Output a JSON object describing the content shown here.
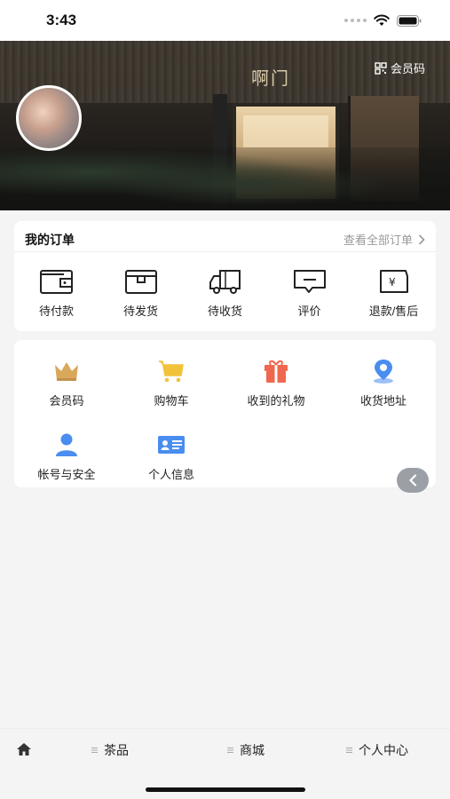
{
  "status_bar": {
    "time": "3:43"
  },
  "hero": {
    "logo_text": "啊门",
    "member_code_label": "会员码"
  },
  "orders": {
    "title": "我的订单",
    "view_all": "查看全部订单",
    "items": [
      {
        "label": "待付款",
        "icon": "wallet-icon"
      },
      {
        "label": "待发货",
        "icon": "package-icon"
      },
      {
        "label": "待收货",
        "icon": "truck-icon"
      },
      {
        "label": "评价",
        "icon": "comment-icon"
      },
      {
        "label": "退款/售后",
        "icon": "refund-icon"
      }
    ]
  },
  "services": {
    "items": [
      {
        "label": "会员码",
        "icon": "crown-icon",
        "color": "#d9a85b"
      },
      {
        "label": "购物车",
        "icon": "cart-icon",
        "color": "#f2c23a"
      },
      {
        "label": "收到的礼物",
        "icon": "gift-icon",
        "color": "#f0674f"
      },
      {
        "label": "收货地址",
        "icon": "location-icon",
        "color": "#4a8df0"
      },
      {
        "label": "帐号与安全",
        "icon": "user-icon",
        "color": "#4a8df0"
      },
      {
        "label": "个人信息",
        "icon": "id-card-icon",
        "color": "#4a8df0"
      }
    ]
  },
  "tabbar": {
    "tabs": [
      {
        "label": "茶品"
      },
      {
        "label": "商城"
      },
      {
        "label": "个人中心"
      }
    ]
  }
}
